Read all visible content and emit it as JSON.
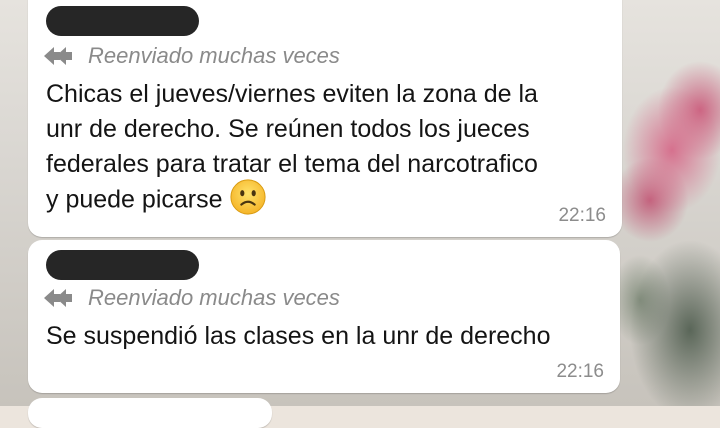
{
  "chat": {
    "messages": [
      {
        "forwarded_label": "Reenviado muchas veces",
        "text": "Chicas el jueves/viernes eviten la zona de la\nunr de derecho. Se reúnen todos los jueces\nfederales para tratar el tema del narcotrafico\ny puede picarse",
        "emoji": "slightly-frowning-face-icon",
        "time": "22:16"
      },
      {
        "forwarded_label": "Reenviado muchas veces",
        "text": "Se suspendió las clases en la unr de derecho",
        "time": "22:16"
      }
    ]
  },
  "colors": {
    "bubble": "#ffffff",
    "text": "#141414",
    "meta": "#8c8c8c",
    "redaction": "#262626"
  }
}
